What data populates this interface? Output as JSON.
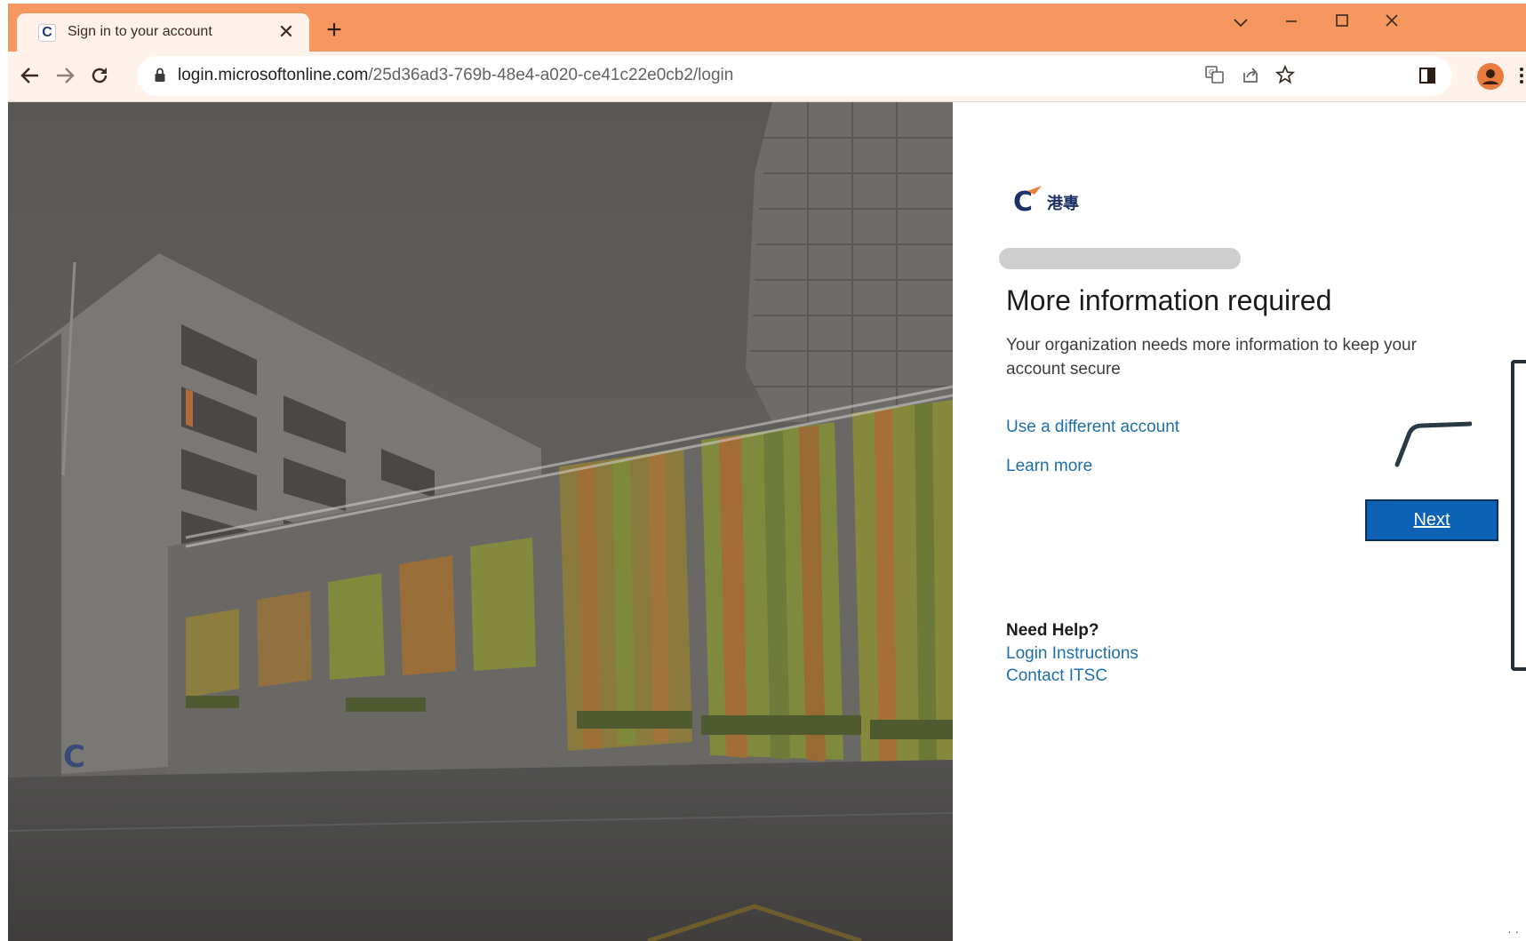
{
  "browser": {
    "tab": {
      "favicon": "C",
      "title": "Sign in to your account"
    },
    "url": {
      "host": "login.microsoftonline.com",
      "path": "/25d36ad3-769b-48e4-a020-ce41c22e0cb2/login"
    },
    "icons": {
      "back": "arrow-left-icon",
      "forward": "arrow-right-icon",
      "reload": "reload-icon",
      "lock": "lock-icon",
      "translate": "translate-icon",
      "share": "share-icon",
      "bookmark": "star-icon",
      "side_panel": "side-panel-icon",
      "profile": "profile-avatar-icon",
      "menu": "kebab-menu-icon"
    },
    "colors": {
      "frame": "#f5975f",
      "toolbar": "#fff2ea",
      "avatar": "#e97b3e"
    }
  },
  "login": {
    "logo_text": "港專",
    "heading": "More information required",
    "description": "Your organization needs more information to keep your account secure",
    "use_different_account": "Use a different account",
    "learn_more": "Learn more",
    "next_button": "Next",
    "help_title": "Need Help?",
    "help_links": [
      "Login Instructions",
      "Contact ITSC"
    ],
    "colors": {
      "link": "#1f6fa8",
      "button": "#0d62b6"
    }
  }
}
